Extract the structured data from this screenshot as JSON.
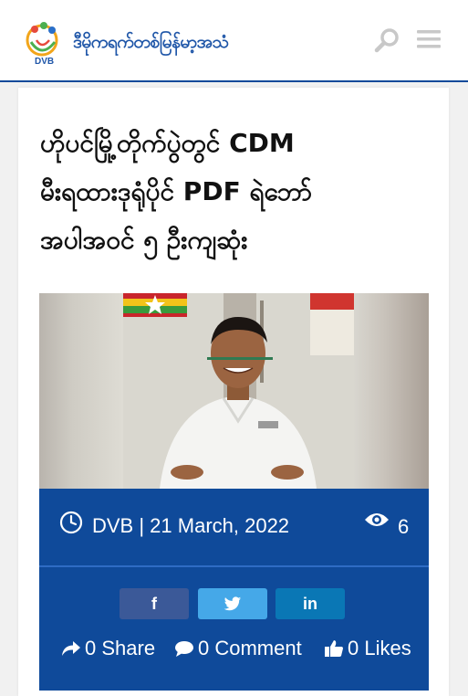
{
  "header": {
    "logo_text": "ဒီမိုကရက်တစ်မြန်မာ့အသံ",
    "logo_badge": "DVB",
    "icons": [
      "search-icon",
      "menu-icon"
    ]
  },
  "article": {
    "title_lines": [
      "ဟိုပင်မြို့တိုက်ပွဲတွင် CDM",
      "မီးရထားဒုရုံပိုင် PDF ရဲဘော်",
      "အပါအဝင် ၅ ဦးကျဆုံး"
    ],
    "byline": "DVB | 21 March, 2022",
    "views": "6",
    "share_buttons": [
      {
        "network": "facebook",
        "glyph": "f",
        "color": "#3b5998"
      },
      {
        "network": "twitter",
        "glyph": "twitter-bird",
        "color": "#45a8e8"
      },
      {
        "network": "linkedin",
        "glyph": "in",
        "color": "#0a77b5"
      }
    ],
    "stats": {
      "share": "0 Share",
      "comment": "0 Comment",
      "likes": "0 Likes"
    }
  },
  "colors": {
    "brand_blue": "#0f4a9a",
    "header_rule": "#0f4a9a",
    "logo_text": "#1f56a8"
  }
}
